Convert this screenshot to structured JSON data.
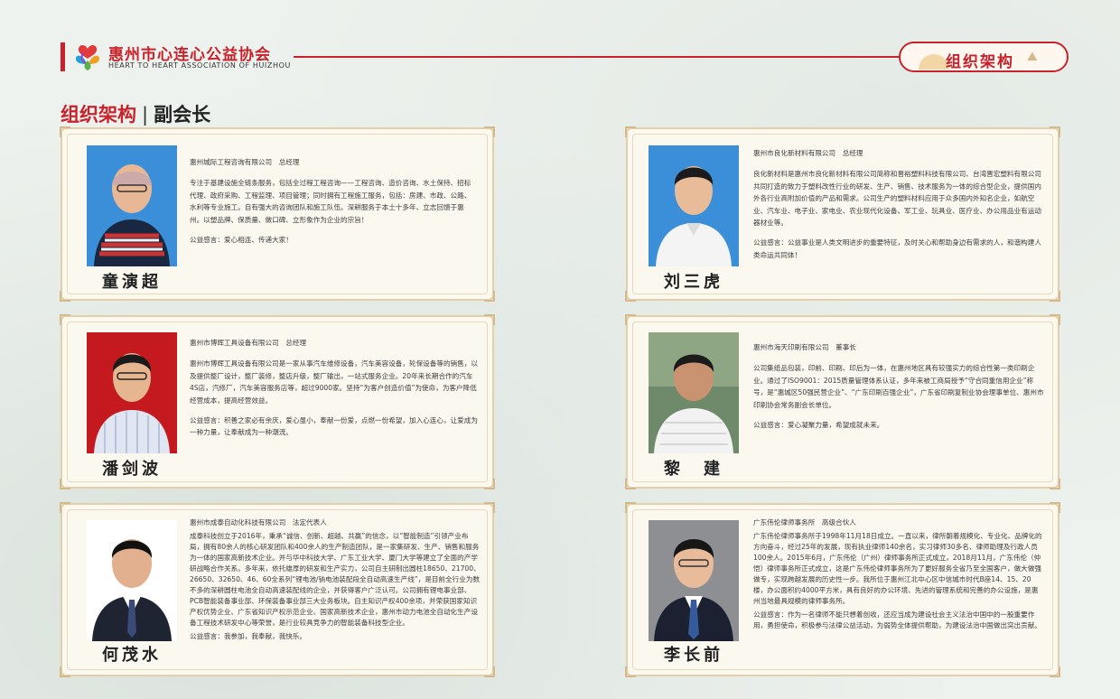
{
  "header": {
    "org_name": "惠州市心连心公益协会",
    "org_name_en": "HEART TO HEART ASSOCIATION OF HUIZHOU",
    "section_badge": "组织架构"
  },
  "page_title": {
    "main": "组织架构",
    "separator": "|",
    "sub": "副会长"
  },
  "colors": {
    "accent_red": "#c8232c",
    "card_border": "#e3cfa8",
    "card_bg": "#fbf8f0",
    "photo_bg_blue": "#3a8fd8",
    "photo_bg_red": "#c4191f",
    "photo_bg_white": "#ffffff"
  },
  "members": [
    {
      "name": "童演超",
      "company": "惠州城际工程咨询有限公司　总经理",
      "bio": "专注于基建设施全链条服务，包括全过程工程咨询——工程咨询、造价咨询、水土保持、招标代理、政府采购、工程监理、项目管理；同时拥有工程施工服务，包括：房建、市政、公路、水利等专业施工。自有强大的咨询团队和施工队伍。深耕服务于本土十多年、立志回馈于惠州。以塑品牌、保质量、做口碑、立形象作为企业的宗旨！",
      "motto": "公益感言：爱心相连、传递大家！"
    },
    {
      "name": "刘三虎",
      "company": "惠州市良化新材料有限公司　总经理",
      "bio": "良化新材料是惠州市良化新材料有限公司简称和晋裕塑料科技有限公司、台湾晋宏塑料有限公司共同打造的致力于塑料改性行业的研发、生产、销售、技术服务为一体的综合型企业，提供国内外各行业高附加价值的产品和需求。公司生产的塑料材料应用于众多国内外知名企业，如航空业、汽车业、电子业、家电业、农业现代化设备、军工业、玩具业、医疗业、办公用品业有运动器材业等。",
      "motto": "公益感言：公益事业是人类文明进步的重要特征，及时关心和帮助身边有需求的人，和谐构建人类命运共同体！"
    },
    {
      "name": "潘剑波",
      "company": "惠州市博辉工具设备有限公司　总经理",
      "bio": "惠州市博辉工具设备有限公司是一家从事汽车维修设备，汽车美容设备，轮保设备等的销售，以及提供整厂设计，整厂装修，整店升级，整厂输出，一站式服务企业。20年来长期合作的汽车4S店，汽修厂，汽车美容服务店等，超过9000家。坚持“为客户创造价值”为使命，为客户降低经营成本，提高经营效益。",
      "motto": "公益感言：积善之家必有余庆，爱心虽小，奉献一份爱，点燃一份希望，加入心连心，让爱成为一种力量，让奉献成为一种潮流。"
    },
    {
      "name": "黎　建",
      "company": "惠州市海天印刷有限公司　董事长",
      "bio": "公司集纸品包装，印前、印刷、印后为一体，在惠州地区具有较强实力的综合性第一类印刷企业。通过了ISO9001：2015质量管理体系认证，多年来被工商局授予“守合同重信用企业”称号，是“惠城区50强民营企业”、“广东印刷百强企业”，广东省印刷复制业协会理事单位、惠州市印刷协会常务副会长单位。",
      "motto": "公益感言：爱心凝聚力量，希望成就未来。"
    },
    {
      "name": "何茂水",
      "company": "惠州市成泰自动化科技有限公司　法定代表人",
      "bio": "成泰科技创立于2016年，秉承“诚信、创新、超越、共赢”的信念，以“智能制造”引领产业布局，拥有80余人的核心研发团队和400余人的生产制造团队，是一家集研发、生产、销售和服务为一体的国家高新技术企业。并与华中科技大学、广东工业大学、厦门大学等建立了全面的产学研战略合作关系。多年来，依托雄厚的研发和生产实力，公司自主研制出圆柱18650、21700、26650、32650、46、60全系列“锂电池/钠电池装配段全自动高速生产线”，是目前全行业为数不多的深耕圆柱电池全自动高速装配线的企业，并获得客户广泛认可。公司拥有锂电事业部、PCB智能装备事业部、环保装备事业部三大业务板块。自主知识产权400余项，并荣获国家知识产权优势企业、广东省知识产权示范企业、国家高新技术企业，惠州市动力电池全自动化生产设备工程技术研发中心等荣誉，是行业较具竞争力的智能装备科技型企业。",
      "motto": "公益感言：我参加，我奉献，我快乐。"
    },
    {
      "name": "李长前",
      "company": "广东伟伦律师事务所　高级合伙人",
      "bio": "广东伟伦律师事务所于1998年11月18日成立。一直以来，律所朝着规模化、专业化、品牌化的方向奋斗，经过25年的发展，现有执业律师140余名，实习律师30多名、律师助理及行政人员100余人。2015年6月，广东伟伦（广州）律师事务所正式成立，2018月11月，广东伟伦（仲恺）律师事务所正式成立，这是广东伟伦律师事务所为了更好服务全省乃至全国客户，做大做强做专，实现跨越发展的历史性一步。我所位于惠州江北中心区中信城市时代B座14、15、20楼，办公面积约4000平方米，具有良好的办公环境、先进的管理系统和完善的办公设施，是惠州当地最具规模的律师事务所。",
      "motto": "公益感言：作为一名律师不能只想着创收，还应当成为建设社会主义法治中国中的一股重要作用，勇担使命，积极参与法律公益活动，为弱势全体提供帮助，为建设法治中国做出突出贡献。"
    }
  ]
}
